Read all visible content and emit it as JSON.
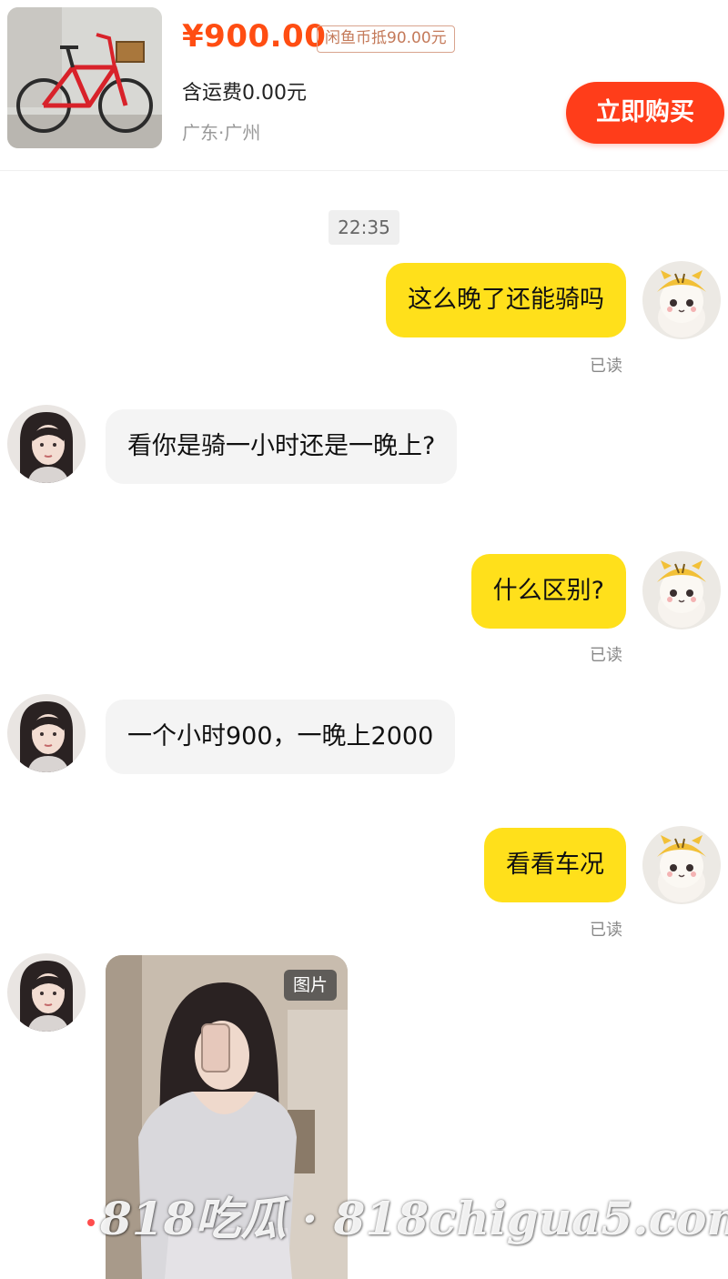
{
  "product": {
    "price": "¥900.00",
    "coin_badge": "闲鱼币抵90.00元",
    "shipping": "含运费0.00元",
    "location": "广东·广州",
    "buy_label": "立即购买"
  },
  "chat": {
    "timestamp": "22:35",
    "read_label": "已读",
    "messages": [
      {
        "from": "me",
        "text": "这么晚了还能骑吗"
      },
      {
        "from": "them",
        "text": "看你是骑一小时还是一晚上?"
      },
      {
        "from": "me",
        "text": "什么区别?"
      },
      {
        "from": "them",
        "text": "一个小时900，一晚上2000"
      },
      {
        "from": "me",
        "text": "看看车况"
      },
      {
        "from": "them",
        "type": "image",
        "tag": "图片"
      }
    ]
  },
  "watermark": "818吃瓜 · 818chigua5.com",
  "colors": {
    "price": "#ff4d12",
    "buy_button": "#ff3d1a",
    "my_bubble": "#ffe01b",
    "their_bubble": "#f4f4f4"
  },
  "icons": {
    "my_avatar": "cartoon-tiger-hat-avatar",
    "their_avatar": "girl-avatar",
    "product_thumb": "red-bicycle-photo"
  }
}
